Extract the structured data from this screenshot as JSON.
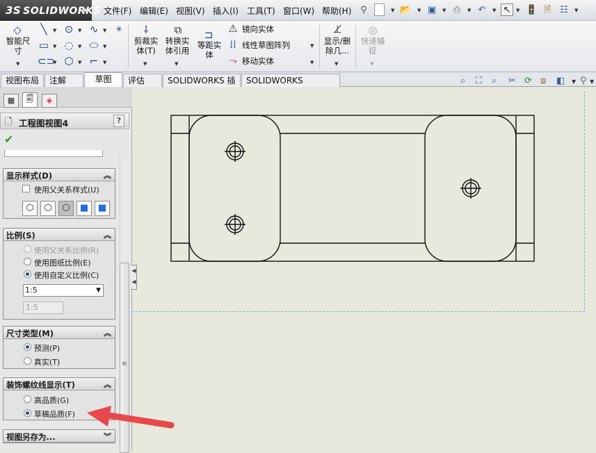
{
  "app": {
    "logo_prefix": "3S",
    "logo_text": "SOLIDWORKS"
  },
  "menu": [
    "文件(F)",
    "编辑(E)",
    "视图(V)",
    "插入(I)",
    "工具(T)",
    "窗口(W)",
    "帮助(H)"
  ],
  "quick_access_icons": [
    "pin-icon",
    "new-document-icon",
    "open-icon",
    "save-icon",
    "print-icon",
    "undo-icon",
    "select-icon",
    "rebuild-icon",
    "file-properties-icon",
    "options-icon"
  ],
  "ribbon": {
    "smart_dimension": "智能尺寸",
    "trim": "剪裁实体(T)",
    "convert": "转换实体引用",
    "offset": "等距实体",
    "mirror": "镜向实体",
    "linear_pattern": "线性草图阵列",
    "move": "移动实体",
    "display_delete": "显示/删除几...",
    "quick_snap": "快速捕捉"
  },
  "tabs": [
    "视图布局",
    "注解",
    "草图",
    "评估",
    "SOLIDWORKS 插件",
    "SOLIDWORKS Inspection"
  ],
  "active_tab": "草图",
  "property_manager": {
    "title": "工程图视图4",
    "help": "?",
    "ok": "✔",
    "display_style": {
      "header": "显示样式(D)",
      "use_parent": "使用父关系样式(U)"
    },
    "scale": {
      "header": "比例(S)",
      "parent": "使用父关系比例(R)",
      "sheet": "使用图纸比例(E)",
      "custom": "使用自定义比例(C)",
      "custom_value": "1:5",
      "ratio_value": "1:5"
    },
    "dimension_type": {
      "header": "尺寸类型(M)",
      "projected": "预测(P)",
      "true": "真实(T)"
    },
    "cosmetic_thread": {
      "header": "装饰螺纹线显示(T)",
      "high": "高品质(G)",
      "draft": "草稿品质(F)"
    },
    "save_view": {
      "header": "视图另存为..."
    }
  },
  "annotation_color": "#e8474c"
}
